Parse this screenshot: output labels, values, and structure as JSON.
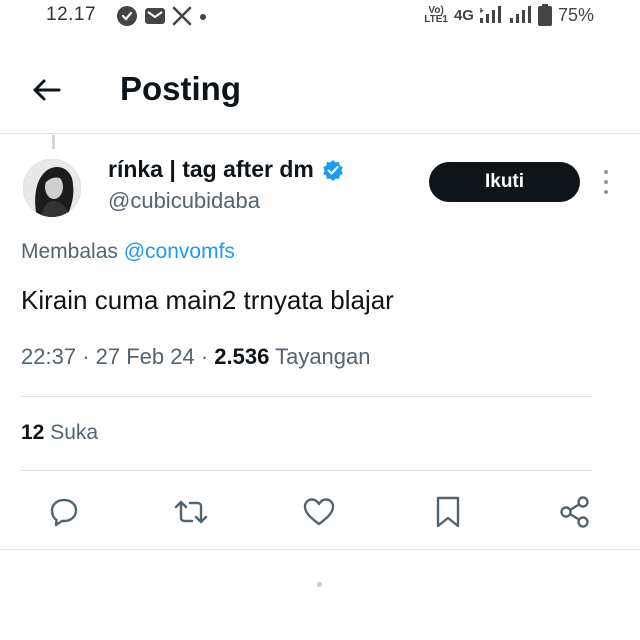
{
  "status_bar": {
    "time": "12.17",
    "network_label_top": "Vo)",
    "network_label_bottom": "LTE1",
    "network_type": "4G",
    "battery": "75%"
  },
  "header": {
    "title": "Posting"
  },
  "tweet": {
    "author_name": "rínka | tag after dm",
    "author_handle": "@cubicubidaba",
    "follow_label": "Ikuti",
    "reply_prefix": "Membalas",
    "reply_to": "@convomfs",
    "text": "Kirain cuma main2 trnyata blajar",
    "time": "22:37",
    "date": "27 Feb 24",
    "views_count": "2.536",
    "views_label": "Tayangan",
    "likes_count": "12",
    "likes_label": "Suka",
    "verified_color": "#1d9bf0"
  },
  "actions": {
    "icons": [
      "reply-icon",
      "retweet-icon",
      "like-icon",
      "bookmark-icon",
      "share-icon"
    ]
  },
  "colors": {
    "text_primary": "#0f1419",
    "text_secondary": "#536471",
    "accent": "#1d9bf0",
    "follow_bg": "#0f1419"
  }
}
